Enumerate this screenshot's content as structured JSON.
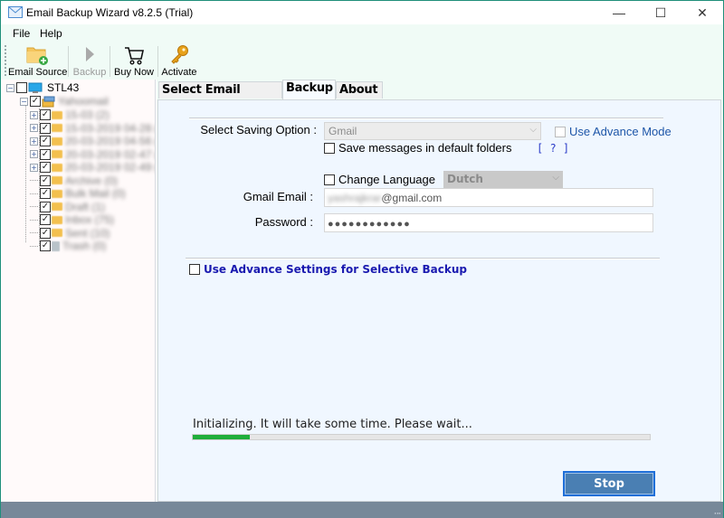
{
  "window": {
    "title": "Email Backup Wizard v8.2.5 (Trial)",
    "controls": {
      "minimize": "—",
      "maximize": "☐",
      "close": "✕"
    }
  },
  "menu": {
    "items": [
      {
        "label": "File"
      },
      {
        "label": "Help"
      }
    ]
  },
  "toolbar": {
    "email_source": {
      "label": "Email Source",
      "icon": "folder-add-icon"
    },
    "backup": {
      "label": "Backup",
      "icon": "play-icon",
      "enabled": false
    },
    "buy_now": {
      "label": "Buy Now",
      "icon": "cart-icon"
    },
    "activate": {
      "label": "Activate",
      "icon": "key-icon"
    }
  },
  "tree": {
    "root": {
      "label": "STL43",
      "checked": false,
      "expanded": true
    },
    "account": {
      "label": "Yahoomail",
      "checked": true,
      "expanded": true,
      "blurred": true
    },
    "folders": [
      {
        "label": "15-03 (2)",
        "checked": true,
        "expandable": true
      },
      {
        "label": "15-03-2019 04-28 (0)",
        "checked": true,
        "expandable": true
      },
      {
        "label": "20-03-2019 04-56 (0)",
        "checked": true,
        "expandable": true
      },
      {
        "label": "20-03-2019 02-47 (0)",
        "checked": true,
        "expandable": true
      },
      {
        "label": "20-03-2019 02-49 (0)",
        "checked": true,
        "expandable": true
      },
      {
        "label": "Archive (0)",
        "checked": true,
        "expandable": false
      },
      {
        "label": "Bulk Mail (0)",
        "checked": true,
        "expandable": false
      },
      {
        "label": "Draft (1)",
        "checked": true,
        "expandable": false
      },
      {
        "label": "Inbox (75)",
        "checked": true,
        "expandable": false
      },
      {
        "label": "Sent (10)",
        "checked": true,
        "expandable": false
      },
      {
        "label": "Trash (0)",
        "checked": true,
        "expandable": false,
        "icon": "trash-icon"
      }
    ]
  },
  "tabs": [
    {
      "label": "Select Email Source",
      "active": false
    },
    {
      "label": "Backup",
      "active": true
    },
    {
      "label": "About",
      "active": false
    }
  ],
  "backup": {
    "saving_option_label": "Select Saving Option :",
    "saving_option_value": "Gmail",
    "use_advance_mode": {
      "label": "Use Advance Mode",
      "checked": false
    },
    "save_default_folders": {
      "label": "Save messages in default folders",
      "checked": false
    },
    "help_link": "[ ? ]",
    "change_language": {
      "label": "Change Language",
      "checked": false,
      "value": "Dutch"
    },
    "gmail_email": {
      "label": "Gmail Email :",
      "value_hidden": "yashrajkrar",
      "value_domain": "@gmail.com"
    },
    "password": {
      "label": "Password :",
      "value": "●●●●●●●●●●●●"
    },
    "advance_settings": {
      "label": "Use Advance Settings for Selective Backup",
      "checked": false
    },
    "status_text": "Initializing. It will take some time. Please wait...",
    "progress_percent": 12.5,
    "stop_label": "Stop"
  },
  "colors": {
    "progress": "#1fae3a",
    "stop_button": "#4a7fb3",
    "link": "#2c3cc8",
    "advance_settings": "#1a1ab0",
    "statusbar": "#778899"
  }
}
